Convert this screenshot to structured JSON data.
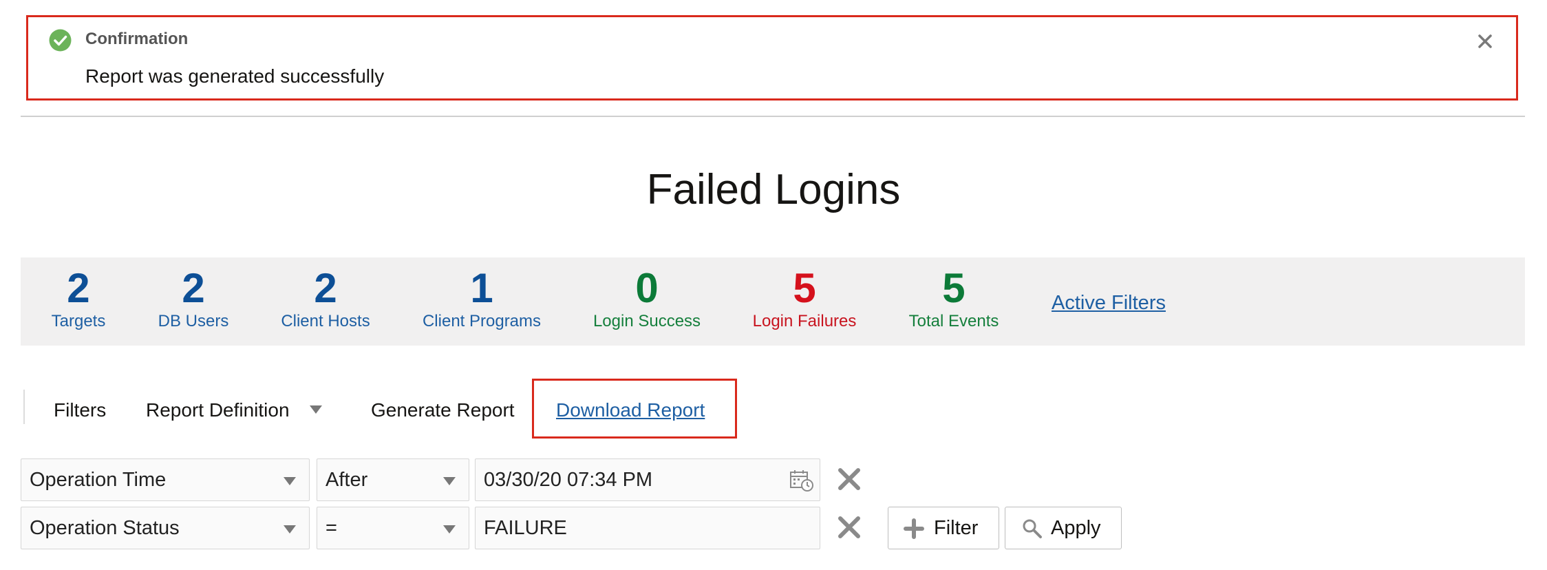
{
  "confirmation": {
    "heading": "Confirmation",
    "message": "Report was generated successfully",
    "icon": "check-circle-icon",
    "close_icon": "close-icon"
  },
  "page": {
    "title": "Failed Logins"
  },
  "metrics": [
    {
      "value": "2",
      "label": "Targets",
      "color": "#0d4f96"
    },
    {
      "value": "2",
      "label": "DB Users",
      "color": "#0d4f96"
    },
    {
      "value": "2",
      "label": "Client Hosts",
      "color": "#0d4f96"
    },
    {
      "value": "1",
      "label": "Client Programs",
      "color": "#0d4f96"
    },
    {
      "value": "0",
      "label": "Login Success",
      "color": "#0c7a38"
    },
    {
      "value": "5",
      "label": "Login Failures",
      "color": "#d5111c"
    },
    {
      "value": "5",
      "label": "Total Events",
      "color": "#0c7a38"
    }
  ],
  "active_filters_label": "Active Filters",
  "toolbar": {
    "filters_label": "Filters",
    "report_definition_label": "Report Definition",
    "generate_report_label": "Generate Report",
    "download_report_label": "Download Report"
  },
  "filter_rows": [
    {
      "field": "Operation Time",
      "operator": "After",
      "value": "03/30/20 07:34 PM"
    },
    {
      "field": "Operation Status",
      "operator": "=",
      "value": "FAILURE"
    }
  ],
  "buttons": {
    "filter_label": "Filter",
    "apply_label": "Apply"
  },
  "colors": {
    "highlight_border": "#d9291c",
    "link": "#1e5fa3",
    "success_green": "#6cb35a"
  }
}
